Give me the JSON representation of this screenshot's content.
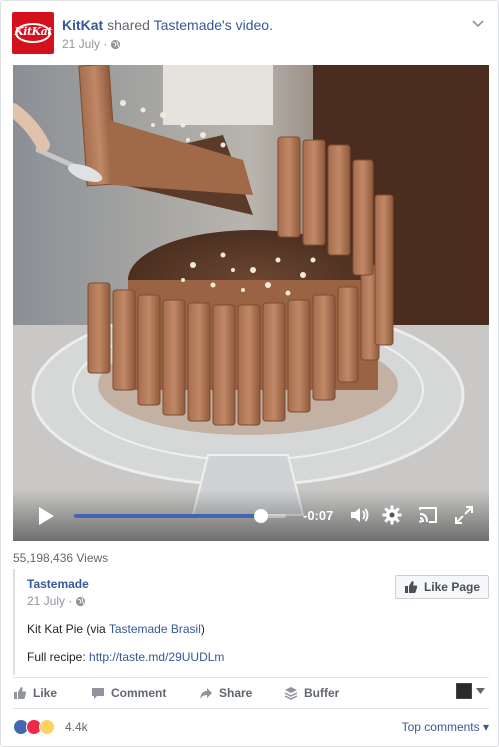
{
  "post": {
    "author": "KitKat",
    "verb": "shared",
    "shared_from": "Tastemade's",
    "object": "video.",
    "date": "21 July ·",
    "logo_text": "KitKat"
  },
  "video": {
    "time_remaining": "-0:07",
    "progress_fraction": 0.88
  },
  "views": "55,198,436 Views",
  "shared_post": {
    "author": "Tastemade",
    "date": "21 July ·",
    "like_page_label": "Like Page",
    "title_prefix": "Kit Kat Pie (via ",
    "title_link": "Tastemade Brasil",
    "title_suffix": ")",
    "recipe_prefix": "Full recipe: ",
    "recipe_link": "http://taste.md/29UUDLm"
  },
  "actions": {
    "like": "Like",
    "comment": "Comment",
    "share": "Share",
    "buffer": "Buffer"
  },
  "reactions": {
    "count": "4.4k",
    "top_comments": "Top comments"
  },
  "colors": {
    "link": "#365899",
    "brand_red": "#d4101c",
    "progress": "#4267b2"
  }
}
